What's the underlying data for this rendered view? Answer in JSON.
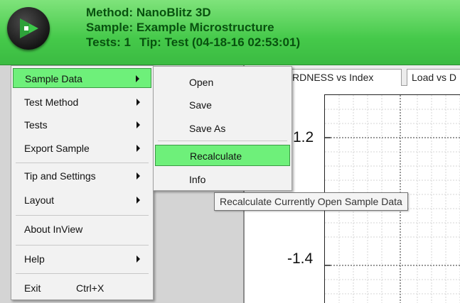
{
  "header": {
    "method": "Method: NanoBlitz 3D",
    "sample": "Sample: Example Microstructure",
    "tests": "Tests: 1",
    "tip": "Tip: Test (04-18-16 02:53:01)"
  },
  "tabs": [
    {
      "label": "RDNESS vs Index"
    },
    {
      "label": "Load vs D"
    }
  ],
  "chart": {
    "yticks": [
      "1.2",
      "-1.4"
    ]
  },
  "menu": {
    "items": [
      {
        "label": "Sample Data"
      },
      {
        "label": "Test Method"
      },
      {
        "label": "Tests"
      },
      {
        "label": "Export Sample"
      },
      {
        "label": "Tip and Settings"
      },
      {
        "label": "Layout"
      },
      {
        "label": "About InView"
      },
      {
        "label": "Help"
      },
      {
        "label": "Exit",
        "shortcut": "Ctrl+X"
      }
    ]
  },
  "submenu": {
    "items": [
      {
        "label": "Open"
      },
      {
        "label": "Save"
      },
      {
        "label": "Save As"
      },
      {
        "label": "Recalculate"
      },
      {
        "label": "Info"
      }
    ]
  },
  "tooltip": "Recalculate Currently Open Sample Data",
  "colors": {
    "header_green": "#45c94a",
    "header_text": "#08520f",
    "highlight": "#6ef07a"
  }
}
